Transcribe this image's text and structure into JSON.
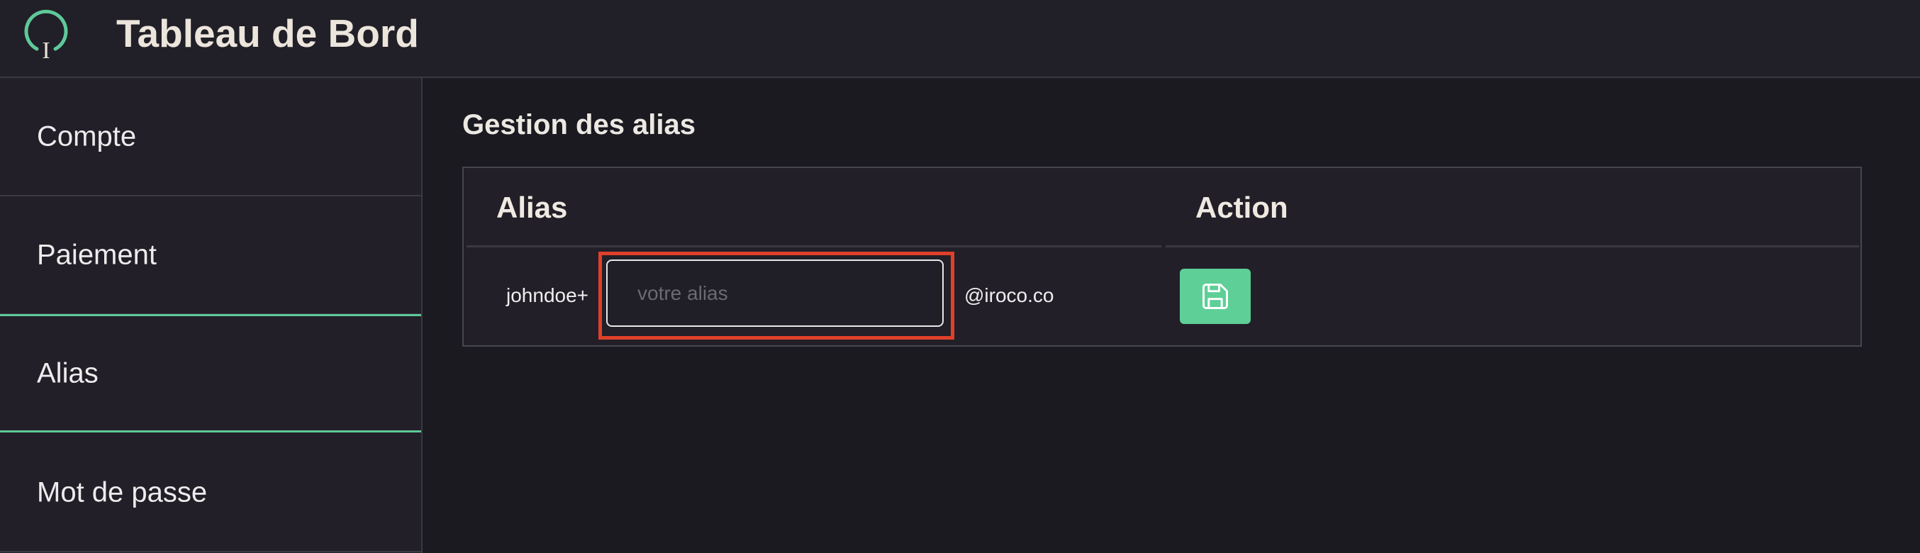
{
  "header": {
    "logo_icon": "iroco-logo-icon",
    "logo_letter": "I",
    "title": "Tableau de Bord"
  },
  "sidebar": {
    "items": [
      {
        "label": "Compte",
        "active": false
      },
      {
        "label": "Paiement",
        "active": false
      },
      {
        "label": "Alias",
        "active": true
      },
      {
        "label": "Mot de passe",
        "active": false
      }
    ]
  },
  "main": {
    "section_title": "Gestion des alias",
    "table": {
      "columns": [
        "Alias",
        "Action"
      ],
      "row": {
        "prefix": "johndoe+",
        "input_value": "",
        "input_placeholder": "votre alias",
        "domain": "@iroco.co",
        "save_icon": "floppy-disk-save-icon"
      }
    }
  },
  "colors": {
    "background": "#1b1a21",
    "panel": "#221f28",
    "accent": "#5ec99a",
    "highlight": "#e0402a"
  }
}
